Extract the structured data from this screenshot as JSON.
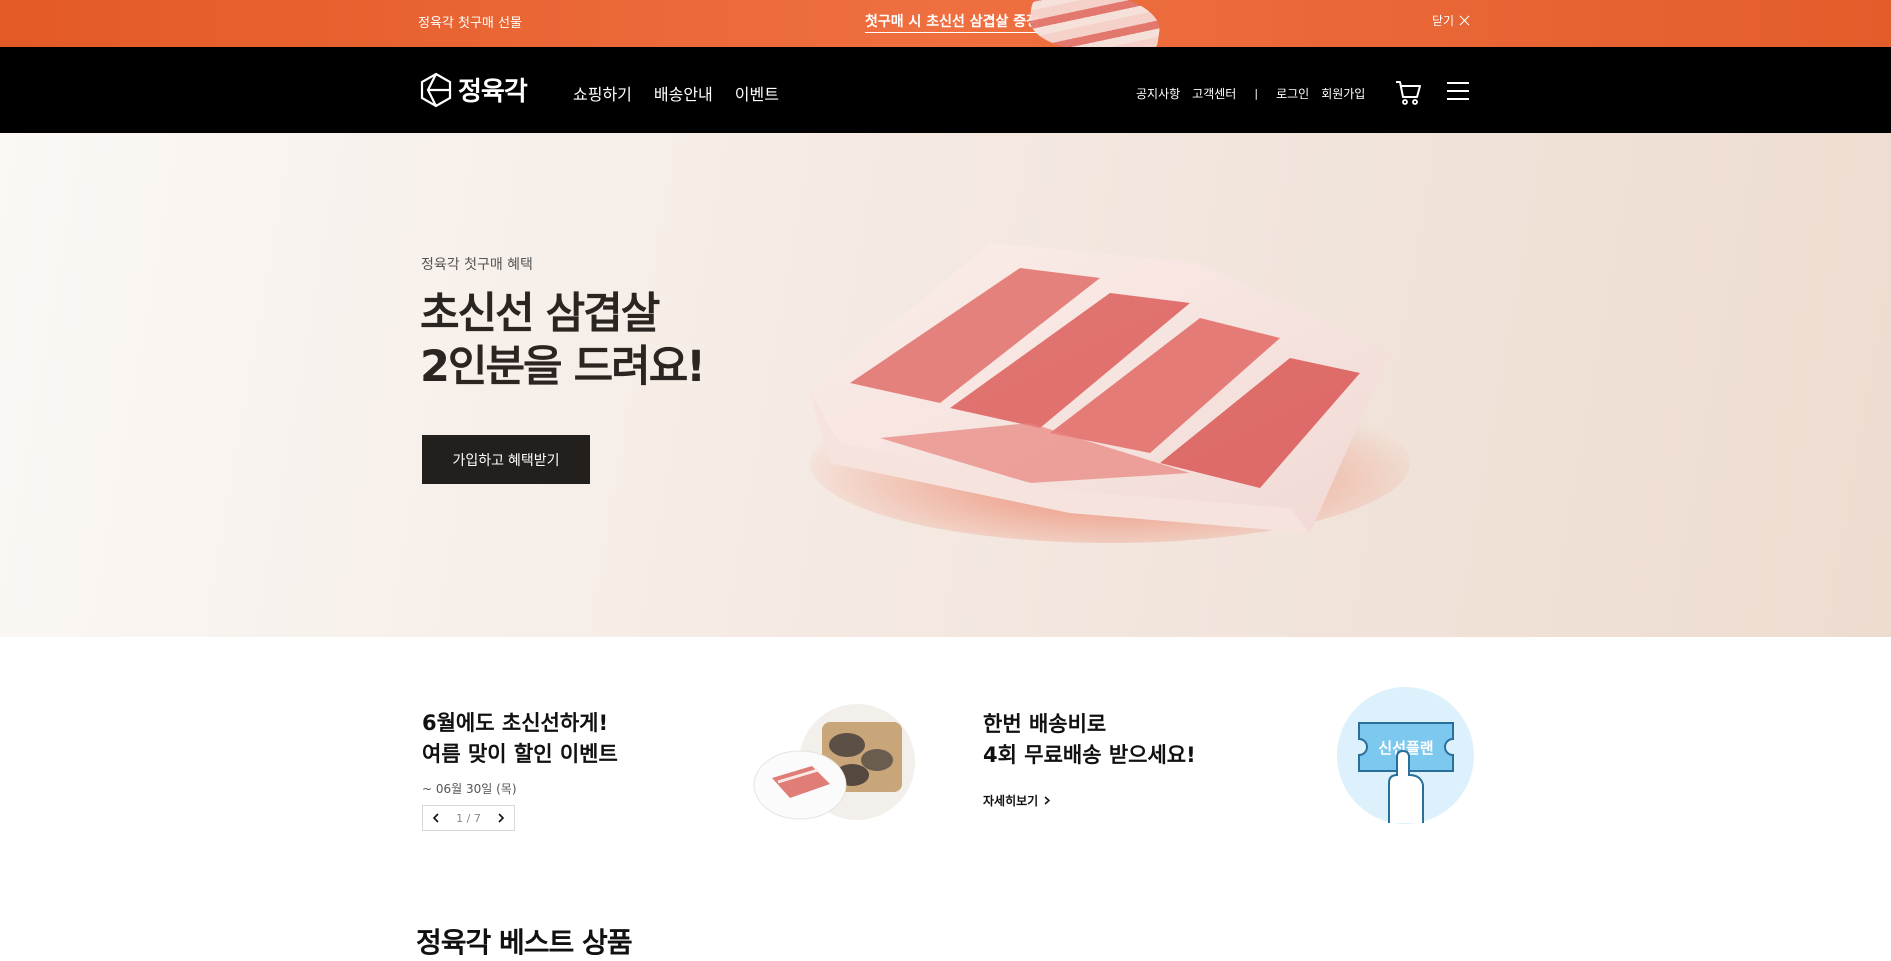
{
  "promo": {
    "left_text": "정육각 첫구매 선물",
    "center_text": "첫구매 시 초신선 삼겹살 증정",
    "close_label": "닫기",
    "background": "#e9612f"
  },
  "header": {
    "logo_text": "정육각",
    "nav": [
      "쇼핑하기",
      "배송안내",
      "이벤트"
    ],
    "util": [
      "공지사항",
      "고객센터",
      "로그인",
      "회원가입"
    ],
    "util_separator": "|",
    "icons": [
      "cart-icon",
      "menu-icon"
    ]
  },
  "hero": {
    "subtitle": "정육각 첫구매 혜택",
    "title_lines": [
      "초신선 삼겹살",
      "2인분을 드려요!"
    ],
    "button_label": "가입하고 혜택받기"
  },
  "event": {
    "title_lines": [
      "6월에도 초신선하게!",
      "여름 맞이 할인 이벤트"
    ],
    "date": "~ 06월 30일 (목)",
    "pager": "1 / 7"
  },
  "shipping": {
    "title_lines": [
      "한번 배송비로",
      "4회 무료배송 받으세요!"
    ],
    "more_label": "자세히보기",
    "badge_text": "신선플랜"
  },
  "best": {
    "title": "정육각 베스트 상품"
  },
  "colors": {
    "accent": "#e9612f",
    "header_bg": "#000000",
    "button_dark": "#231f1d",
    "badge_blue": "#7cc8ee"
  }
}
